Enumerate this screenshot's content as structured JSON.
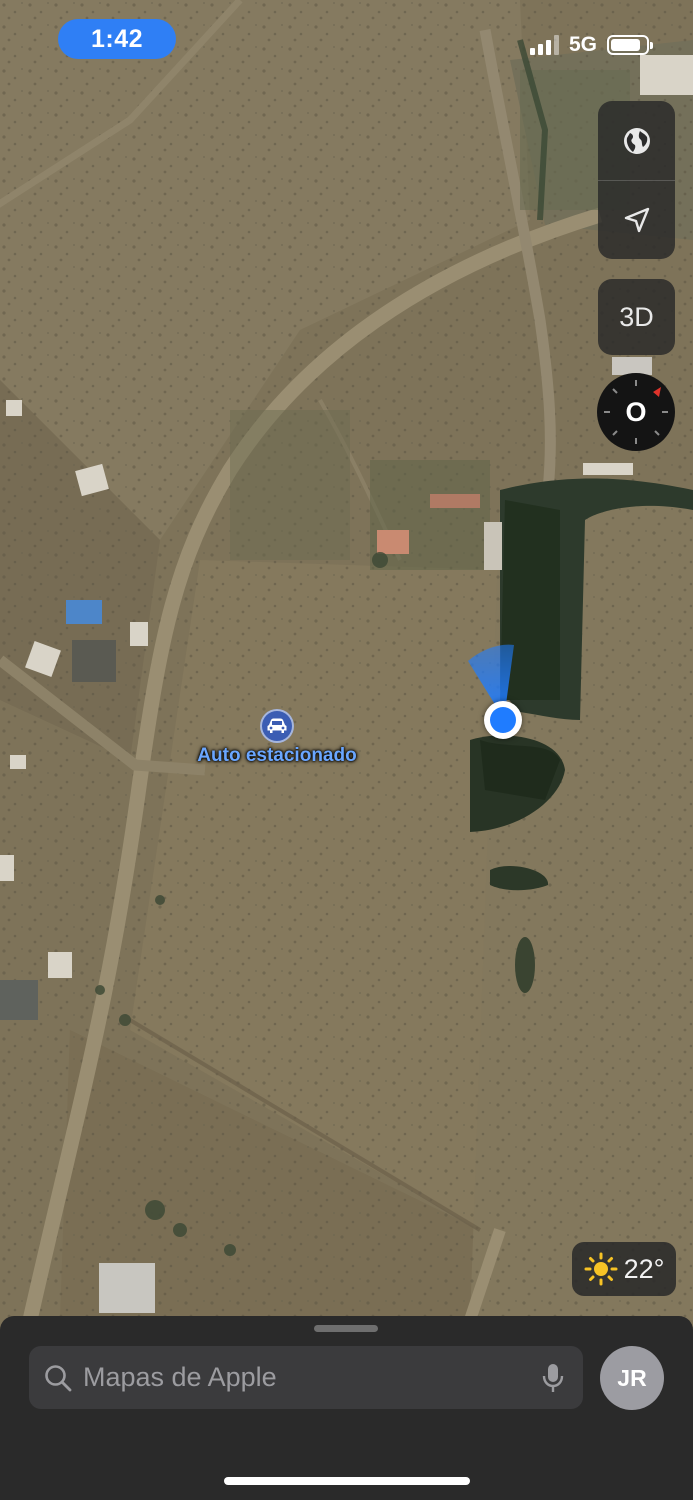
{
  "status_bar": {
    "time": "1:42",
    "network": "5G",
    "signal_bars": 3,
    "battery_level": 0.85
  },
  "map": {
    "type": "satellite",
    "parked_car": {
      "label": "Auto estacionado",
      "icon": "car-icon"
    },
    "user_location": {
      "icon": "location-dot-icon",
      "color": "#1f7cff"
    }
  },
  "controls": {
    "map_mode_icon": "globe-icon",
    "tracking_icon": "location-arrow-icon",
    "view_3d_label": "3D",
    "compass_letter": "O"
  },
  "weather": {
    "icon": "sun-icon",
    "temperature": "22°"
  },
  "search": {
    "placeholder": "Mapas de Apple",
    "search_icon": "search-icon",
    "mic_icon": "microphone-icon"
  },
  "profile": {
    "initials": "JR"
  },
  "colors": {
    "accent": "#2f7ff5",
    "label": "#6aa6ff",
    "sheet": "#2a2a2a"
  }
}
